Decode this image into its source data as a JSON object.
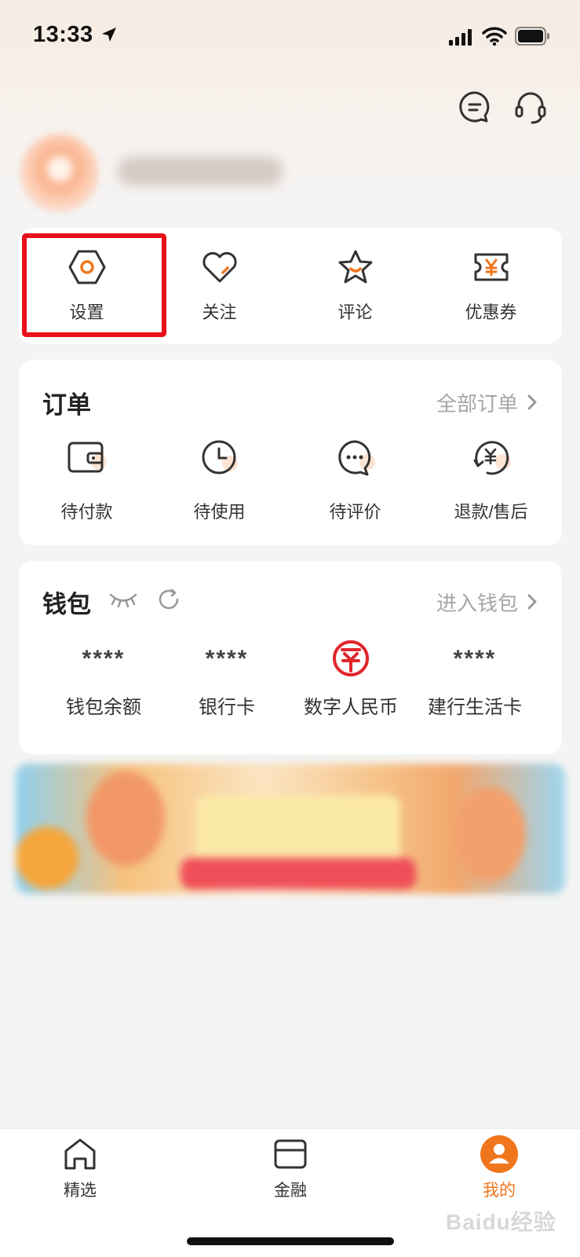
{
  "status_bar": {
    "time": "13:33"
  },
  "quick_actions": [
    {
      "label": "设置",
      "icon": "settings-hexagon-icon"
    },
    {
      "label": "关注",
      "icon": "heart-icon"
    },
    {
      "label": "评论",
      "icon": "star-icon"
    },
    {
      "label": "优惠券",
      "icon": "coupon-icon"
    }
  ],
  "orders": {
    "title": "订单",
    "all_link": "全部订单",
    "items": [
      {
        "label": "待付款",
        "icon": "wallet-icon"
      },
      {
        "label": "待使用",
        "icon": "clock-icon"
      },
      {
        "label": "待评价",
        "icon": "chat-bubble-icon"
      },
      {
        "label": "退款/售后",
        "icon": "refund-icon"
      }
    ]
  },
  "wallet": {
    "title": "钱包",
    "enter_link": "进入钱包",
    "items": [
      {
        "value": "****",
        "label": "钱包余额"
      },
      {
        "value": "****",
        "label": "银行卡"
      },
      {
        "value": "",
        "label": "数字人民币",
        "icon": "digital-rmb-icon"
      },
      {
        "value": "****",
        "label": "建行生活卡"
      }
    ]
  },
  "tabbar": {
    "tabs": [
      {
        "label": "精选",
        "icon": "home-icon",
        "active": false
      },
      {
        "label": "金融",
        "icon": "card-icon",
        "active": false
      },
      {
        "label": "我的",
        "icon": "user-avatar-icon",
        "active": true
      }
    ]
  },
  "watermark": "Baidu经验",
  "colors": {
    "accent": "#f0761d",
    "highlight": "#e8101a",
    "rmb_red": "#e0262c"
  }
}
